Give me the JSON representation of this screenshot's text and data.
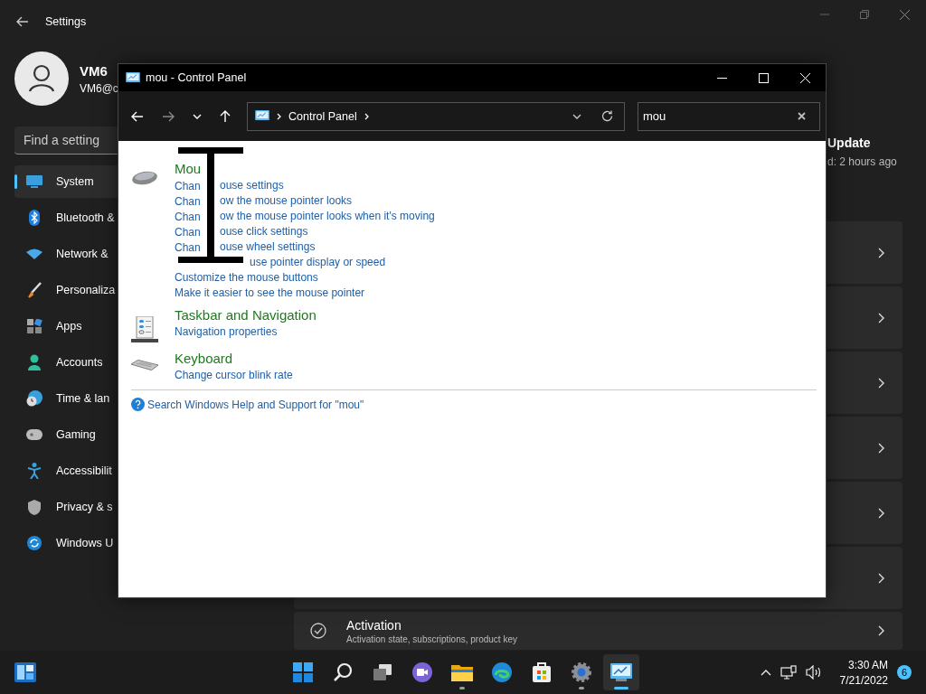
{
  "settings": {
    "title": "Settings",
    "user": {
      "name": "VM6",
      "email": "VM6@c"
    },
    "search": {
      "placeholder": "Find a setting"
    },
    "nav": [
      {
        "label": "System",
        "selected": true
      },
      {
        "label": "Bluetooth &",
        "selected": false
      },
      {
        "label": "Network &",
        "selected": false
      },
      {
        "label": "Personaliza",
        "selected": false
      },
      {
        "label": "Apps",
        "selected": false
      },
      {
        "label": "Accounts",
        "selected": false
      },
      {
        "label": "Time & lan",
        "selected": false
      },
      {
        "label": "Gaming",
        "selected": false
      },
      {
        "label": "Accessibilit",
        "selected": false
      },
      {
        "label": "Privacy & s",
        "selected": false
      },
      {
        "label": "Windows U",
        "selected": false
      }
    ],
    "update": {
      "title": "Update",
      "subtitle": "d: 2 hours ago"
    },
    "cards": [
      {
        "kind": "covered"
      },
      {
        "kind": "covered"
      },
      {
        "kind": "covered"
      },
      {
        "kind": "covered"
      },
      {
        "kind": "covered"
      },
      {
        "kind": "covered"
      },
      {
        "kind": "item",
        "title": "Activation",
        "subtitle": "Activation state, subscriptions, product key"
      }
    ]
  },
  "control_panel": {
    "title": "mou - Control Panel",
    "address": "Control Panel",
    "search": {
      "value": "mou"
    },
    "results": [
      {
        "title": "Mou",
        "links": [
          {
            "kind": "covered_middle",
            "before": "Chan",
            "after": "ouse settings"
          },
          {
            "kind": "covered_middle",
            "before": "Chan",
            "after": "ow the mouse pointer looks"
          },
          {
            "kind": "covered_middle",
            "before": "Chan",
            "after": "ow the mouse pointer looks when it's moving"
          },
          {
            "kind": "covered_middle",
            "before": "Chan",
            "after": "ouse click settings"
          },
          {
            "kind": "covered_middle",
            "before": "Chan",
            "after": "ouse wheel settings"
          },
          {
            "kind": "covered_start",
            "after": "use pointer display or speed"
          },
          {
            "kind": "plain",
            "text": "Customize the mouse buttons"
          },
          {
            "kind": "plain",
            "text": "Make it easier to see the mouse pointer"
          }
        ]
      },
      {
        "title": "Taskbar and Navigation",
        "links": [
          {
            "kind": "plain",
            "text": "Navigation properties"
          }
        ]
      },
      {
        "title": "Keyboard",
        "links": [
          {
            "kind": "plain",
            "text": "Change cursor blink rate"
          }
        ]
      }
    ],
    "help_link": "Search Windows Help and Support for \"mou\""
  },
  "taskbar": {
    "apps": [
      {
        "running": false,
        "selected": false
      },
      {
        "running": false,
        "selected": false
      },
      {
        "running": false,
        "selected": false
      },
      {
        "running": false,
        "selected": false
      },
      {
        "running": true,
        "selected": false
      },
      {
        "running": false,
        "selected": false
      },
      {
        "running": false,
        "selected": false
      },
      {
        "running": true,
        "selected": false
      },
      {
        "running": true,
        "selected": true
      }
    ],
    "time": "3:30 AM",
    "date": "7/21/2022",
    "notifications": "6"
  }
}
